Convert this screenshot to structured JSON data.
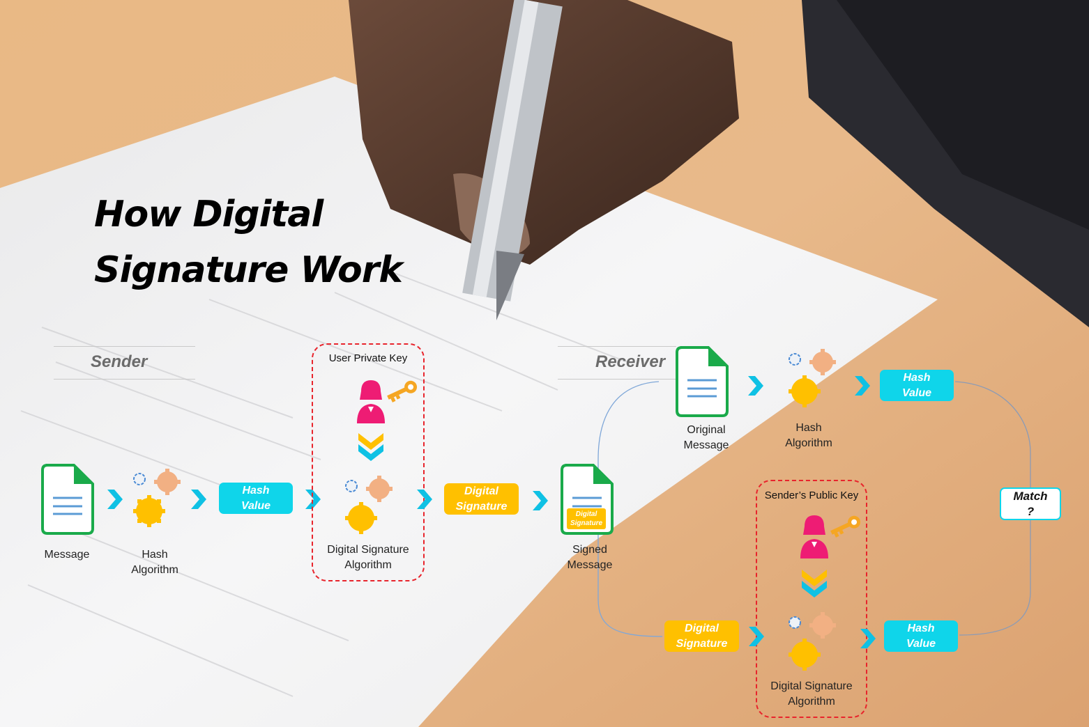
{
  "title": {
    "line1": "How Digital",
    "line2": "Signature Work"
  },
  "sender": {
    "heading": "Sender",
    "message_label": "Message",
    "hash_algorithm_label": [
      "Hash",
      "Algorithm"
    ],
    "hash_value": [
      "Hash",
      "Value"
    ],
    "key_box_label": "User Private Key",
    "dsa_label": [
      "Digital Signature",
      "Algorithm"
    ],
    "digital_signature": [
      "Digital",
      "Signature"
    ],
    "signed_message_label": [
      "Signed",
      "Message"
    ],
    "signed_doc_badge": [
      "Digital",
      "Signature"
    ]
  },
  "receiver": {
    "heading": "Receiver",
    "original_message_label": [
      "Original",
      "Message"
    ],
    "hash_algorithm_label": [
      "Hash",
      "Algorithm"
    ],
    "hash_value_top": [
      "Hash",
      "Value"
    ],
    "key_box_label": "Sender’s  Public Key",
    "digital_signature": [
      "Digital",
      "Signature"
    ],
    "dsa_label": [
      "Digital Signature",
      "Algorithm"
    ],
    "hash_value_bottom": [
      "Hash",
      "Value"
    ],
    "match": [
      "Match",
      "?"
    ]
  },
  "colors": {
    "cyan": "#0fd5ea",
    "gold": "#ffc000",
    "doc_green": "#1aaa4a",
    "user_pink": "#ee1c74",
    "key_orange": "#f5a623",
    "dashed_red": "#e8242c"
  }
}
